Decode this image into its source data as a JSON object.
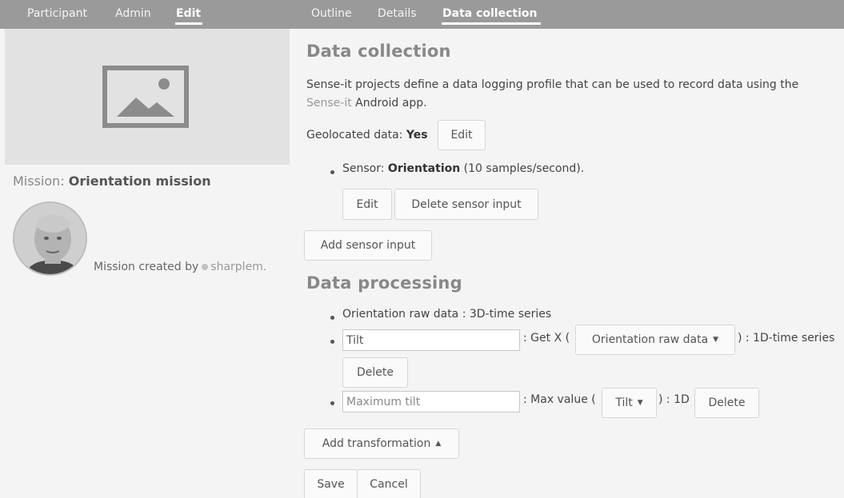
{
  "nav": {
    "left": [
      "Participant",
      "Admin",
      "Edit"
    ],
    "right": [
      "Outline",
      "Details",
      "Data collection"
    ]
  },
  "mission": {
    "label": "Mission:",
    "name": "Orientation mission",
    "created_by_text": "Mission created by",
    "username": "sharplem."
  },
  "data_collection": {
    "heading": "Data collection",
    "description_line1": "Sense-it projects define a data logging profile that can be used to record data using the",
    "description_link": "Sense-it",
    "description_tail": "Android app.",
    "geolocated_label": "Geolocated data:",
    "geolocated_value": "Yes",
    "edit_label": "Edit",
    "sensor_label": "Sensor:",
    "sensor_name": "Orientation",
    "sensor_rate": "(10 samples/second).",
    "sensor_edit": "Edit",
    "sensor_delete": "Delete sensor input",
    "add_sensor": "Add sensor input"
  },
  "data_processing": {
    "heading": "Data processing",
    "raw_item": "Orientation raw data : 3D-time series",
    "tilt_value": "Tilt",
    "tilt_op": ": Get X (",
    "tilt_source": "Orientation raw data",
    "tilt_result": ") : 1D-time series",
    "delete_label": "Delete",
    "max_value": "Maximum tilt",
    "max_op": ": Max value (",
    "max_source": "Tilt",
    "max_result": ") : 1D",
    "max_delete": "Delete",
    "add_transformation": "Add transformation"
  },
  "footer": {
    "save": "Save",
    "cancel": "Cancel"
  }
}
